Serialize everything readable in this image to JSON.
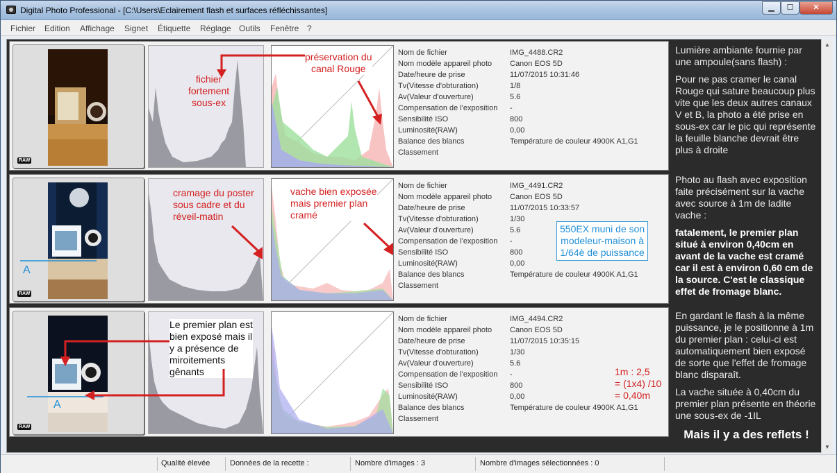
{
  "window": {
    "title": "Digital Photo Professional - [C:\\Users\\Eclairement flash et surfaces réfléchissantes]",
    "btn_min": "▁",
    "btn_max": "☐",
    "btn_close": "✕"
  },
  "menu": [
    "Fichier",
    "Edition",
    "Affichage",
    "Signet",
    "Étiquette",
    "Réglage",
    "Outils",
    "Fenêtre",
    "?"
  ],
  "info_labels": [
    "Nom de fichier",
    "Nom modèle appareil photo",
    "Date/heure de prise",
    "Tv(Vitesse d'obturation)",
    "Av(Valeur d'ouverture)",
    "Compensation de l'exposition",
    "Sensibilité ISO",
    "Luminosité(RAW)",
    "Balance des blancs",
    "Classement"
  ],
  "raw_badge": "RAW",
  "images": [
    {
      "values": [
        "IMG_4488.CR2",
        "Canon EOS 5D",
        "11/07/2015 10:31:46",
        "1/8",
        "5.6",
        "-",
        "800",
        "0,00",
        "Température de couleur 4900K A1,G1",
        ""
      ],
      "ann_hist1": [
        "fichier",
        "fortement",
        "sous-ex"
      ],
      "ann_hist2": [
        "préservation du",
        "canal Rouge"
      ]
    },
    {
      "values": [
        "IMG_4491.CR2",
        "Canon EOS 5D",
        "11/07/2015 10:33:57",
        "1/30",
        "5.6",
        "-",
        "800",
        "0,00",
        "Température de couleur 4900K A1,G1",
        ""
      ],
      "ann_hist1": [
        "cramage du poster",
        "sous cadre et du",
        "réveil-matin"
      ],
      "ann_hist2": [
        "vache bien exposée",
        "mais premier plan",
        "cramé"
      ],
      "bluebox": [
        "550EX muni de son",
        "modeleur-maison à",
        "1/64è de puissance"
      ],
      "letter": "A"
    },
    {
      "values": [
        "IMG_4494.CR2",
        "Canon EOS 5D",
        "11/07/2015 10:35:15",
        "1/30",
        "5.6",
        "-",
        "800",
        "0,00",
        "Température de couleur 4900K A1,G1",
        ""
      ],
      "ann_dark": [
        "Le premier plan est",
        "bien exposé mais il",
        "y a présence de",
        "miroitements",
        "gênants"
      ],
      "calc": [
        "1m : 2,5",
        "= (1x4) /10",
        "= 0,40m"
      ],
      "letter": "A"
    }
  ],
  "side_notes": {
    "p1": "Lumière ambiante fournie par une ampoule(sans flash) :",
    "p2": "Pour ne pas cramer le canal Rouge qui sature beaucoup plus vite que les deux autres canaux  V et B, la photo a été prise en sous-ex car le pic qui représente la feuille blanche devrait être plus à droite",
    "p3": "Photo au flash avec exposition faite précisément sur la vache avec source à 1m de ladite vache :",
    "p4": "fatalement, le premier plan situé à environ 0,40cm en avant de la vache est cramé car il est à environ 0,60 cm de la source. C'est le classique effet de fromage blanc.",
    "p5": "En gardant le flash à la même puissance, je le positionne à 1m du premier plan : celui-ci est automatiquement bien exposé de sorte que l'effet de fromage blanc disparaît.",
    "p6": "La vache située à 0,40cm du premier plan présente en théorie une sous-ex de -1IL",
    "p7": "Mais il y a des reflets !"
  },
  "status": {
    "quality": "Qualité élevée",
    "recipe": "Données de la recette :",
    "count": "Nombre d'images : 3",
    "selected": "Nombre d'images sélectionnées : 0"
  }
}
